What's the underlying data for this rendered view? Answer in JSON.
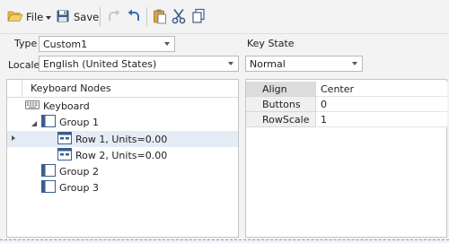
{
  "toolbar": {
    "file_label": "File",
    "save_label": "Save"
  },
  "form": {
    "type_label": "Type",
    "type_value": "Custom1",
    "locale_label": "Locale",
    "locale_value": "English (United States)",
    "key_state_label": "Key State",
    "key_state_value": "Normal"
  },
  "tree": {
    "header": "Keyboard Nodes",
    "nodes": [
      {
        "label": "Keyboard"
      },
      {
        "label": "Group 1"
      },
      {
        "label": "Row 1, Units=0.00"
      },
      {
        "label": "Row 2, Units=0.00"
      },
      {
        "label": "Group 2"
      },
      {
        "label": "Group 3"
      }
    ]
  },
  "properties": {
    "rows": [
      {
        "key": "Align",
        "value": "Center"
      },
      {
        "key": "Buttons",
        "value": "0"
      },
      {
        "key": "RowScale",
        "value": "1"
      }
    ]
  },
  "colors": {
    "accent": "#2f6fb8",
    "selection": "#e5ecf6"
  }
}
